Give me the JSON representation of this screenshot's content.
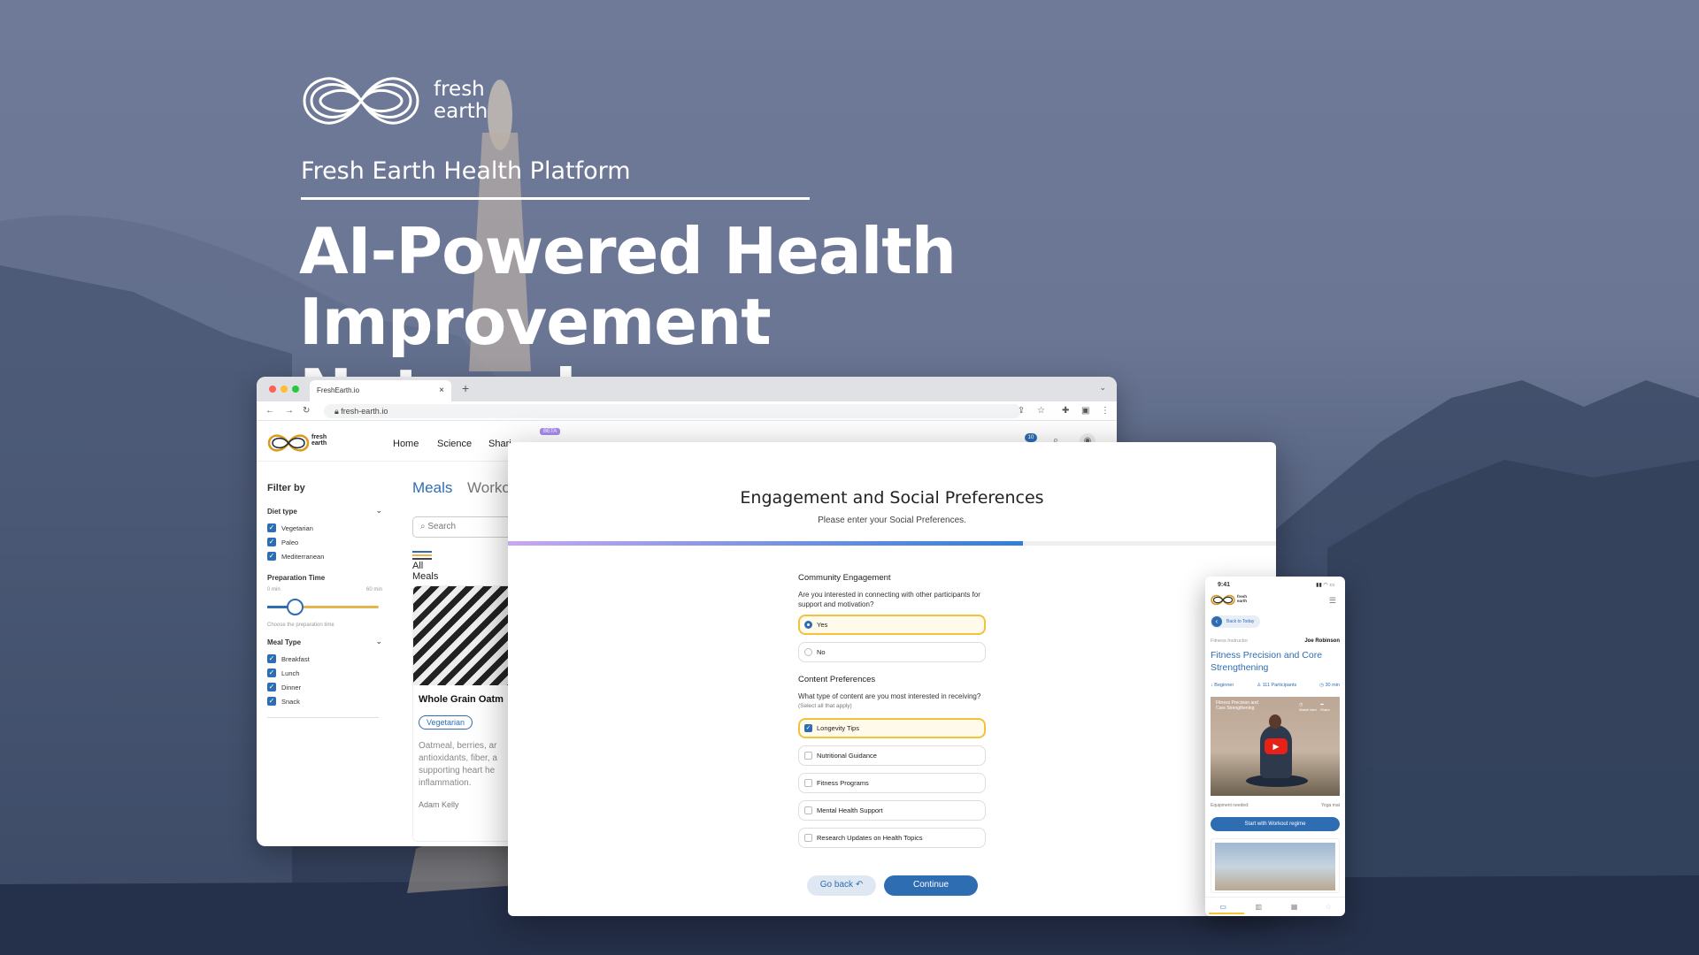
{
  "hero": {
    "brand_line1": "fresh",
    "brand_line2": "earth",
    "subtitle": "Fresh Earth Health Platform",
    "headline_line1": "AI-Powered Health Improvement",
    "headline_line2": "Network"
  },
  "browser": {
    "tab_title": "FreshEarth.io",
    "url": "fresh-earth.io",
    "logo_line1": "fresh",
    "logo_line2": "earth",
    "nav": [
      "Home",
      "Science",
      "Shari"
    ],
    "beta_badge": "BETA",
    "notification_count": "10",
    "filter": {
      "title": "Filter by",
      "diet_type_label": "Diet type",
      "diet_types": [
        "Vegetarian",
        "Paleo",
        "Mediterranean"
      ],
      "prep_time_label": "Preparation Time",
      "prep_min": "0 min",
      "prep_max": "60 min",
      "prep_hint": "Choose the preparation time",
      "meal_type_label": "Meal Type",
      "meal_types": [
        "Breakfast",
        "Lunch",
        "Dinner",
        "Snack"
      ]
    },
    "main": {
      "tab_meals": "Meals",
      "tab_workouts": "Worko",
      "search_placeholder": "Search",
      "all_meals": "All Meals",
      "card_title": "Whole Grain Oatm",
      "card_tag": "Vegetarian",
      "card_desc_1": "Oatmeal, berries, ar",
      "card_desc_2": "antioxidants, fiber, a",
      "card_desc_3": "supporting heart he",
      "card_desc_4": "inflammation.",
      "card_author": "Adam Kelly"
    }
  },
  "modal": {
    "title": "Engagement and Social Preferences",
    "subtitle": "Please enter your Social Preferences.",
    "progress": 0.67,
    "community": {
      "label": "Community Engagement",
      "question": "Are you interested in connecting with other participants for support and motivation?",
      "options": [
        "Yes",
        "No"
      ],
      "selected": "Yes"
    },
    "content": {
      "label": "Content Preferences",
      "question": "What type of content are you most interested in receiving?",
      "hint": "(Select all that apply)",
      "options": [
        "Longevity Tips",
        "Nutritional Guidance",
        "Fitness Programs",
        "Mental Health Support",
        "Research Updates on Health Topics"
      ],
      "selected": [
        "Longevity Tips"
      ]
    },
    "back_label": "Go back",
    "continue_label": "Continue"
  },
  "phone": {
    "time": "9:41",
    "logo_line1": "fresh",
    "logo_line2": "earth",
    "back_label": "Back to Today",
    "role": "Fitness Instructor",
    "instructor": "Joe Robinson",
    "title": "Fitness Precision and Core Strengthening",
    "level": "Beginner",
    "participants": "111 Participants",
    "duration": "30 min",
    "video_title": "Fitness Precision and Core Strengthening",
    "watch_later": "Watch later",
    "share": "Share",
    "equipment_label": "Equipment needed:",
    "equipment": "Yoga mat",
    "start_button": "Start with Workout regime"
  },
  "colors": {
    "accent": "#2f6db3",
    "highlight": "#f2c23a",
    "logo_gold": "#d99a1e"
  }
}
